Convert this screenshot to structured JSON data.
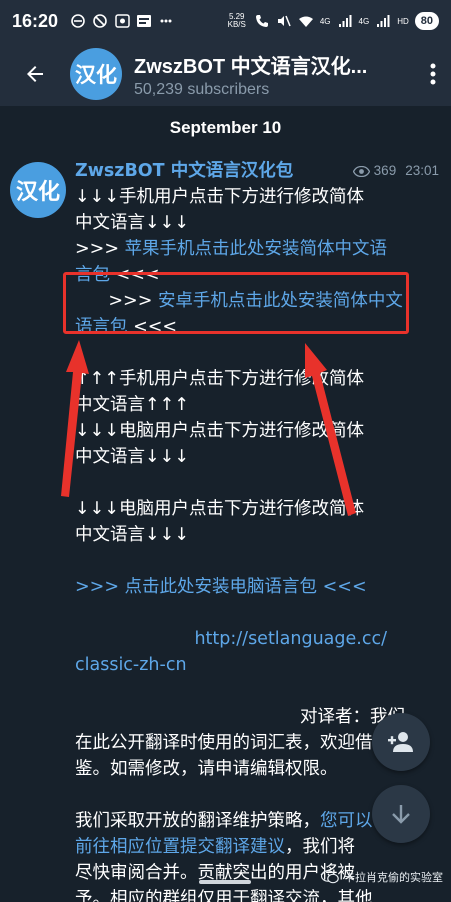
{
  "status_bar": {
    "time": "16:20",
    "speed_value": "5.29",
    "speed_unit": "KB/S",
    "net_tag_1": "4G",
    "net_tag_2": "4G",
    "hd_tag": "HD",
    "battery": "80"
  },
  "header": {
    "avatar_text": "汉化",
    "title": "ZwszBOT 中文语言汉化...",
    "subtitle": "50,239 subscribers"
  },
  "date_label": "September 10",
  "message": {
    "avatar_text": "汉化",
    "author": "ZwszBOT 中文语言汉化包",
    "views": "369",
    "time": "23:01",
    "line_1": "↓↓↓手机用户点击下方进行修改简体",
    "line_2": "中文语言↓↓↓",
    "ios_prefix": ">>> ",
    "ios_link_a": "苹果手机点击此处安装简体中文语",
    "ios_link_b": "言包",
    "ios_suffix": " <<<",
    "android_prefix": "      >>> ",
    "android_link_a": "安卓手机点击此处安装简体中文",
    "android_link_b": "语言包",
    "android_suffix": " <<<",
    "line_up_1": "↑↑↑手机用户点击下方进行修改简体",
    "line_up_2": "中文语言↑↑↑",
    "line_pc_1": "↓↓↓电脑用户点击下方进行修改简体",
    "line_pc_2": "中文语言↓↓↓",
    "line_pc_3": "↓↓↓电脑用户点击下方进行修改简体",
    "line_pc_4": "中文语言↓↓↓",
    "pc_link": ">>> 点击此处安装电脑语言包 <<<",
    "url_a": "http://setlanguage.cc/",
    "url_b": "classic-zh-cn",
    "translator_label": "对译者：我们",
    "para_1a": "在此公开翻译时使用的词汇表，欢迎借",
    "para_1b": "鉴。如需修改，请申请编辑权限。",
    "para_2a_text": "我们采取开放的翻译维护策略，",
    "para_2a_link": "您可以",
    "para_2b_link": "前往相应位置提交翻译建议",
    "para_2b_text": "，我们将",
    "para_2c": "尽快审阅合并。贡献突出的用户将被",
    "para_2d": "予。相应的群组仅用于翻译交流，其他"
  },
  "watermark": "卡拉肖克偷的实验室",
  "colors": {
    "background": "#17212b",
    "header": "#232e3c",
    "link": "#5ea7e8",
    "annotation": "#e8322b"
  }
}
